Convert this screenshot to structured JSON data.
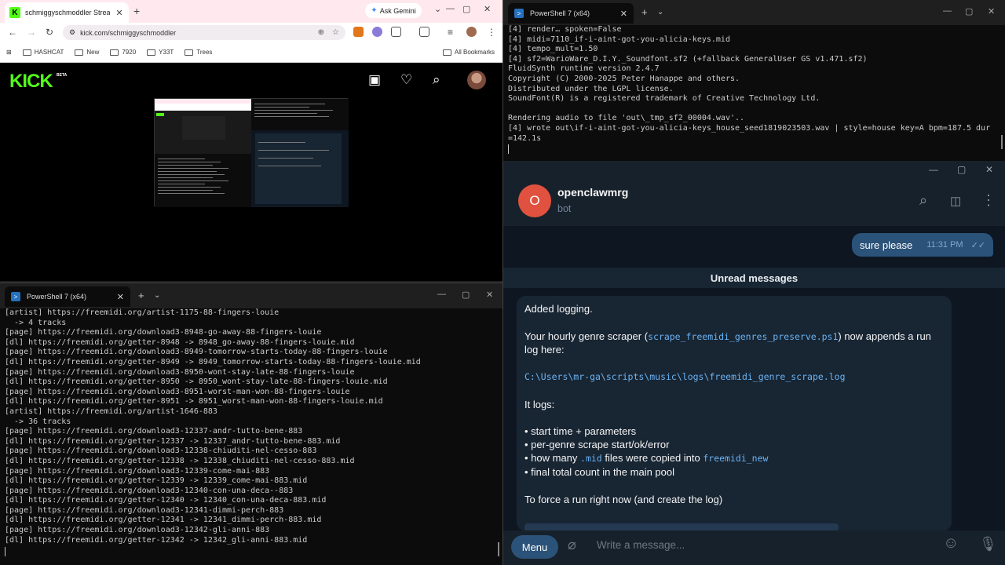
{
  "browser": {
    "tab_title": "schmiggyschmoddler Stream -",
    "new_tab": "+",
    "gemini_label": "Ask Gemini",
    "url": "kick.com/schmiggyschmoddler",
    "bookmarks": [
      "HASHCAT",
      "New",
      "7920",
      "Y33T",
      "Trees"
    ],
    "all_bookmarks": "All Bookmarks",
    "kick_logo": "KICK",
    "kick_beta": "BETA"
  },
  "ps_top": {
    "tab_title": "PowerShell 7 (x64)",
    "lines": [
      "[4] render… spoken=False",
      "[4] midi=7110_if-i-aint-got-you-alicia-keys.mid",
      "[4] tempo_mult=1.50",
      "[4] sf2=WarioWare_D.I.Y._Soundfont.sf2 (+fallback GeneralUser GS v1.471.sf2)",
      "FluidSynth runtime version 2.4.7",
      "Copyright (C) 2000-2025 Peter Hanappe and others.",
      "Distributed under the LGPL license.",
      "SoundFont(R) is a registered trademark of Creative Technology Ltd.",
      "",
      "Rendering audio to file 'out\\_tmp_sf2_00004.wav'..",
      "[4] wrote out\\if-i-aint-got-you-alicia-keys_house_seed1819023503.wav | style=house key=A bpm=187.5 dur",
      "=142.1s"
    ]
  },
  "telegram": {
    "avatar_letter": "O",
    "chat_name": "openclawmrg",
    "chat_status": "bot",
    "out_message": "sure please",
    "out_time": "11:31 PM",
    "unread_label": "Unread messages",
    "msg": {
      "l1": "Added logging.",
      "l2_pre": "Your hourly genre scraper (",
      "l2_code": "scrape_freemidi_genres_preserve.ps1",
      "l2_post": ") now appends a run",
      "l3": "log here:",
      "path": "C:\\Users\\mr-ga\\scripts\\music\\logs\\freemidi_genre_scrape.log",
      "logs_title": "It logs:",
      "b1": "• start time + parameters",
      "b2": "• per-genre scrape start/ok/error",
      "b3_pre": "• how many ",
      "b3_code1": ".mid",
      "b3_mid": " files were copied into ",
      "b3_code2": "freemidi_new",
      "b4": "• final total count in the main pool",
      "force": "To force a run right now (and create the log)"
    },
    "menu_label": "Menu",
    "input_placeholder": "Write a message..."
  },
  "ps_bottom": {
    "tab_title": "PowerShell 7 (x64)",
    "lines": [
      "[artist] https://freemidi.org/artist-1175-88-fingers-louie",
      "  -> 4 tracks",
      "[page] https://freemidi.org/download3-8948-go-away-88-fingers-louie",
      "[dl] https://freemidi.org/getter-8948 -> 8948_go-away-88-fingers-louie.mid",
      "[page] https://freemidi.org/download3-8949-tomorrow-starts-today-88-fingers-louie",
      "[dl] https://freemidi.org/getter-8949 -> 8949_tomorrow-starts-today-88-fingers-louie.mid",
      "[page] https://freemidi.org/download3-8950-wont-stay-late-88-fingers-louie",
      "[dl] https://freemidi.org/getter-8950 -> 8950_wont-stay-late-88-fingers-louie.mid",
      "[page] https://freemidi.org/download3-8951-worst-man-won-88-fingers-louie",
      "[dl] https://freemidi.org/getter-8951 -> 8951_worst-man-won-88-fingers-louie.mid",
      "[artist] https://freemidi.org/artist-1646-883",
      "  -> 36 tracks",
      "[page] https://freemidi.org/download3-12337-andr-tutto-bene-883",
      "[dl] https://freemidi.org/getter-12337 -> 12337_andr-tutto-bene-883.mid",
      "[page] https://freemidi.org/download3-12338-chiuditi-nel-cesso-883",
      "[dl] https://freemidi.org/getter-12338 -> 12338_chiuditi-nel-cesso-883.mid",
      "[page] https://freemidi.org/download3-12339-come-mai-883",
      "[dl] https://freemidi.org/getter-12339 -> 12339_come-mai-883.mid",
      "[page] https://freemidi.org/download3-12340-con-una-deca--883",
      "[dl] https://freemidi.org/getter-12340 -> 12340_con-una-deca-883.mid",
      "[page] https://freemidi.org/download3-12341-dimmi-perch-883",
      "[dl] https://freemidi.org/getter-12341 -> 12341_dimmi-perch-883.mid",
      "[page] https://freemidi.org/download3-12342-gli-anni-883",
      "[dl] https://freemidi.org/getter-12342 -> 12342_gli-anni-883.mid"
    ]
  },
  "colors": {
    "kick_green": "#53fc18",
    "telegram_bg": "#0e1621",
    "telegram_bubble_out": "#2b5278",
    "terminal_bg": "#0c0c0c"
  }
}
